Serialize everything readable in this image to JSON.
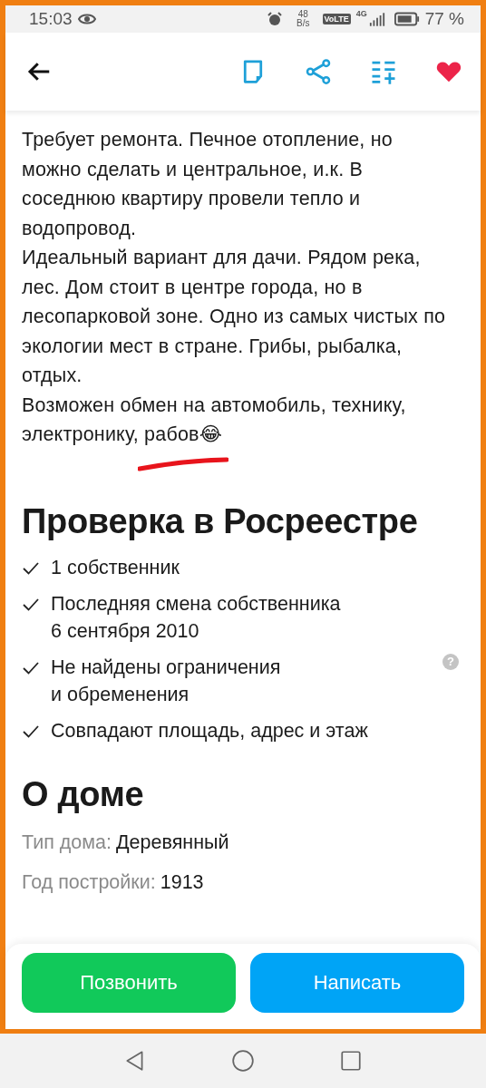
{
  "status_bar": {
    "time": "15:03",
    "speed_value": "48",
    "speed_unit": "B/s",
    "volte": "VoLTE",
    "network": "4G",
    "battery": "77 %"
  },
  "description": [
    "Требует ремонта. Печное отопление, но можно сделать и центральное, и.к. В соседнюю квартиру провели тепло и водопровод.",
    "Идеальный вариант для дачи. Рядом река, лес. Дом стоит в центре города, но в лесопарковой зоне. Одно из самых чистых по экологии мест в стране. Грибы, рыбалка, отдых.",
    "Возможен обмен на автомобиль, технику, электронику, рабов😂"
  ],
  "registry": {
    "title": "Проверка в Росреестре",
    "items": [
      {
        "text": "1 собственник"
      },
      {
        "text": "Последняя смена собственника\n6 сентября 2010"
      },
      {
        "text": "Не найдены ограничения\nи обременения",
        "help": "?"
      },
      {
        "text": "Совпадают площадь, адрес и этаж"
      }
    ]
  },
  "house": {
    "title": "О доме",
    "rows": [
      {
        "label": "Тип дома:",
        "value": "Деревянный"
      },
      {
        "label": "Год постройки:",
        "value": "1913"
      }
    ]
  },
  "actions": [
    {
      "label": "Позвонить",
      "kind": "call"
    },
    {
      "label": "Написать",
      "kind": "write"
    }
  ]
}
